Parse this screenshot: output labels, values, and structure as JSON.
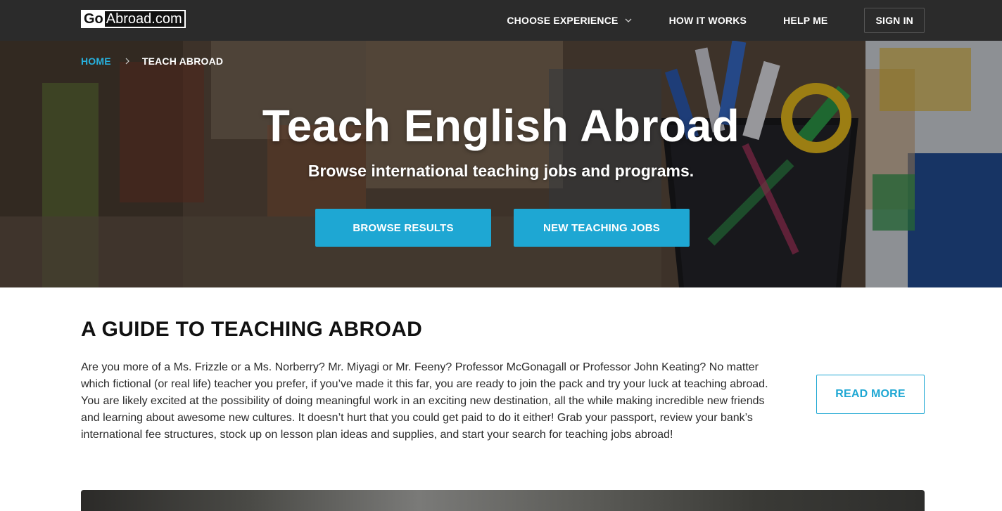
{
  "nav": {
    "logo_go": "Go",
    "logo_rest": "Abroad.com",
    "items": [
      {
        "label": "CHOOSE EXPERIENCE"
      },
      {
        "label": "HOW IT WORKS"
      },
      {
        "label": "HELP ME"
      },
      {
        "label": "SIGN IN"
      }
    ]
  },
  "breadcrumb": {
    "home": "HOME",
    "current": "TEACH ABROAD"
  },
  "hero": {
    "title": "Teach English Abroad",
    "subtitle": "Browse international teaching jobs and programs.",
    "buttons": [
      {
        "label": "BROWSE RESULTS"
      },
      {
        "label": "NEW TEACHING JOBS"
      }
    ]
  },
  "guide": {
    "title": "A GUIDE TO TEACHING ABROAD",
    "body": "Are you more of a Ms. Frizzle or a Ms. Norberry? Mr. Miyagi or Mr. Feeny? Professor McGonagall or Professor John Keating? No matter which fictional (or real life) teacher you prefer, if you’ve made it this far, you are ready to join the pack and try your luck at teaching abroad. You are likely excited at the possibility of doing meaningful work in an exciting new destination, all the while making incredible new friends and learning about awesome new cultures. It doesn’t hurt that you could get paid to do it either! Grab your passport, review your bank’s international fee structures, stock up on lesson plan ideas and supplies, and start your search for teaching jobs abroad!",
    "read_more": "READ MORE"
  },
  "colors": {
    "accent": "#1ea7d3",
    "nav_bg": "#2b2b2b",
    "breadcrumb_link": "#27b1de"
  },
  "icons": {
    "dropdown": "chevron-down-icon",
    "breadcrumb_sep": "chevron-right-icon"
  }
}
